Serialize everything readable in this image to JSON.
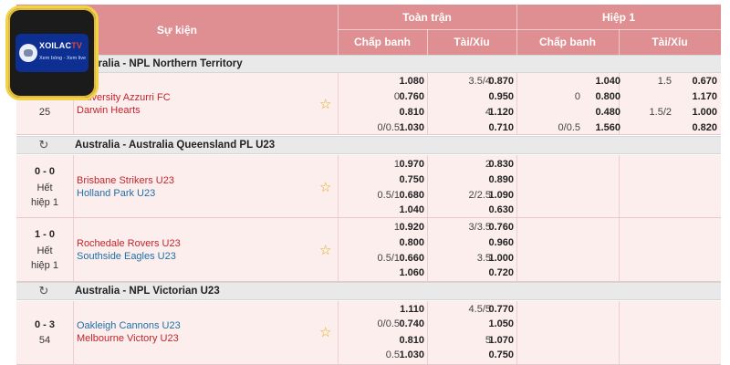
{
  "header": {
    "event": "Sự kiện",
    "full_match": "Toàn trận",
    "first_half": "Hiệp 1",
    "handicap": "Chấp banh",
    "over_under": "Tài/Xỉu"
  },
  "logo": {
    "brand_white": "XOILAC",
    "brand_red": "TV",
    "tagline": "Xem bóng - Xem live"
  },
  "colors": {
    "header_bg": "#df8f92",
    "row_bg": "#fdeeee",
    "league_bg": "#e9e9e9",
    "home_team": "#c0262c",
    "away_team": "#1f6fa6",
    "star": "#e0a816"
  },
  "leagues": [
    {
      "name": "Australia - NPL Northern Territory",
      "matches": [
        {
          "score": "",
          "status": [
            "25"
          ],
          "home": "University Azzurri FC",
          "away": "Darwin Hearts",
          "lines": [
            {
              "ft_hdp": "",
              "ft_hdp_odds": [
                "1.080",
                "0.760"
              ],
              "ft_ou": "3.5/4",
              "ft_ou_odds": [
                "0.870",
                "0.950"
              ],
              "h1_hdp": "",
              "h1_hdp_odds": [
                "1.040",
                "0.800"
              ],
              "h1_ou": "1.5",
              "h1_ou_odds": [
                "0.670",
                "1.170"
              ],
              "hdp_side": "0",
              "h1_side": "0"
            },
            {
              "ft_hdp": "",
              "ft_hdp_odds": [
                "0.810",
                "1.030"
              ],
              "ft_ou": "4",
              "ft_ou_odds": [
                "1.120",
                "0.710"
              ],
              "h1_hdp": "",
              "h1_hdp_odds": [
                "0.480",
                "1.560"
              ],
              "h1_ou": "1.5/2",
              "h1_ou_odds": [
                "1.000",
                "0.820"
              ],
              "hdp_side": "0/0.5",
              "h1_side": "0/0.5"
            }
          ]
        }
      ]
    },
    {
      "name": "Australia - Australia Queensland PL U23",
      "matches": [
        {
          "score": "0 - 0",
          "status": [
            "Hết",
            "hiệp 1"
          ],
          "home": "Brisbane Strikers U23",
          "away": "Holland Park U23",
          "lines": [
            {
              "hdp_side": "1",
              "ft_hdp_odds": [
                "0.970",
                "0.750"
              ],
              "ft_ou": "2",
              "ft_ou_odds": [
                "0.830",
                "0.890"
              ]
            },
            {
              "hdp_side": "0.5/1",
              "ft_hdp_odds": [
                "0.680",
                "1.040"
              ],
              "ft_ou": "2/2.5",
              "ft_ou_odds": [
                "1.090",
                "0.630"
              ]
            }
          ]
        },
        {
          "score": "1 - 0",
          "status": [
            "Hết",
            "hiệp 1"
          ],
          "home": "Rochedale Rovers U23",
          "away": "Southside Eagles U23",
          "lines": [
            {
              "hdp_side": "1",
              "ft_hdp_odds": [
                "0.920",
                "0.800"
              ],
              "ft_ou": "3/3.5",
              "ft_ou_odds": [
                "0.760",
                "0.960"
              ]
            },
            {
              "hdp_side": "0.5/1",
              "ft_hdp_odds": [
                "0.660",
                "1.060"
              ],
              "ft_ou": "3.5",
              "ft_ou_odds": [
                "1.000",
                "0.720"
              ]
            }
          ]
        }
      ]
    },
    {
      "name": "Australia - NPL Victorian U23",
      "matches": [
        {
          "score": "0 - 3",
          "status": [
            "54"
          ],
          "home": "Oakleigh Cannons U23",
          "away": "Melbourne Victory U23",
          "lines": [
            {
              "hdp_side": "0/0.5",
              "ft_hdp_odds": [
                "1.110",
                "0.740"
              ],
              "ft_ou": "4.5/5",
              "ft_ou_odds": [
                "0.770",
                "1.050"
              ]
            },
            {
              "hdp_side": "0.5",
              "ft_hdp_odds": [
                "0.810",
                "1.030"
              ],
              "ft_ou": "5",
              "ft_ou_odds": [
                "1.070",
                "0.750"
              ]
            }
          ]
        }
      ]
    }
  ]
}
